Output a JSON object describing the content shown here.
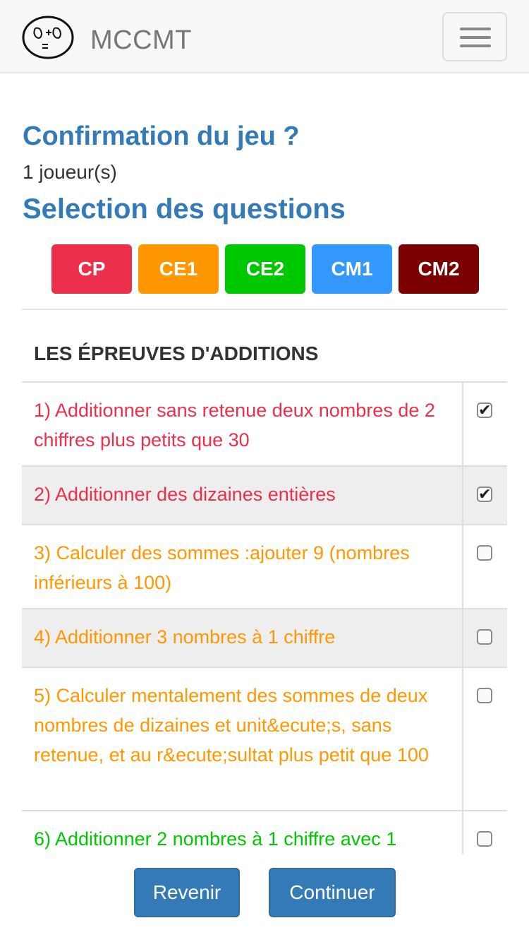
{
  "app": {
    "brand": "MCCMT"
  },
  "page": {
    "title": "Confirmation du jeu ?",
    "players": "1 joueur(s)",
    "selection_title": "Selection des questions"
  },
  "levels": [
    {
      "label": "CP",
      "color": "#ec2f4b"
    },
    {
      "label": "CE1",
      "color": "#ff9800"
    },
    {
      "label": "CE2",
      "color": "#00c800"
    },
    {
      "label": "CM1",
      "color": "#3399ff"
    },
    {
      "label": "CM2",
      "color": "#7b0000"
    }
  ],
  "section": {
    "title": "LES ÉPREUVES D'ADDITIONS"
  },
  "questions": [
    {
      "text": "1) Additionner sans retenue deux nombres de 2 chiffres plus petits que 30",
      "color": "#ec2f4b",
      "checked": true
    },
    {
      "text": "2) Additionner des dizaines entières",
      "color": "#ec2f4b",
      "checked": true
    },
    {
      "text": "3) Calculer des sommes :ajouter 9 (nombres inférieurs à 100)",
      "color": "#ff9800",
      "checked": false
    },
    {
      "text": "4) Additionner 3 nombres à 1 chiffre",
      "color": "#ff9800",
      "checked": false
    },
    {
      "text": "5) Calculer mentalement des sommes de deux nombres de dizaines et unit&ecute;s, sans retenue, et au r&ecute;sultat plus petit que 100",
      "color": "#ff9800",
      "checked": false
    },
    {
      "text": "6) Additionner 2 nombres à 1 chiffre avec 1",
      "color": "#00c800",
      "checked": false
    }
  ],
  "actions": {
    "back": "Revenir",
    "continue": "Continuer"
  }
}
